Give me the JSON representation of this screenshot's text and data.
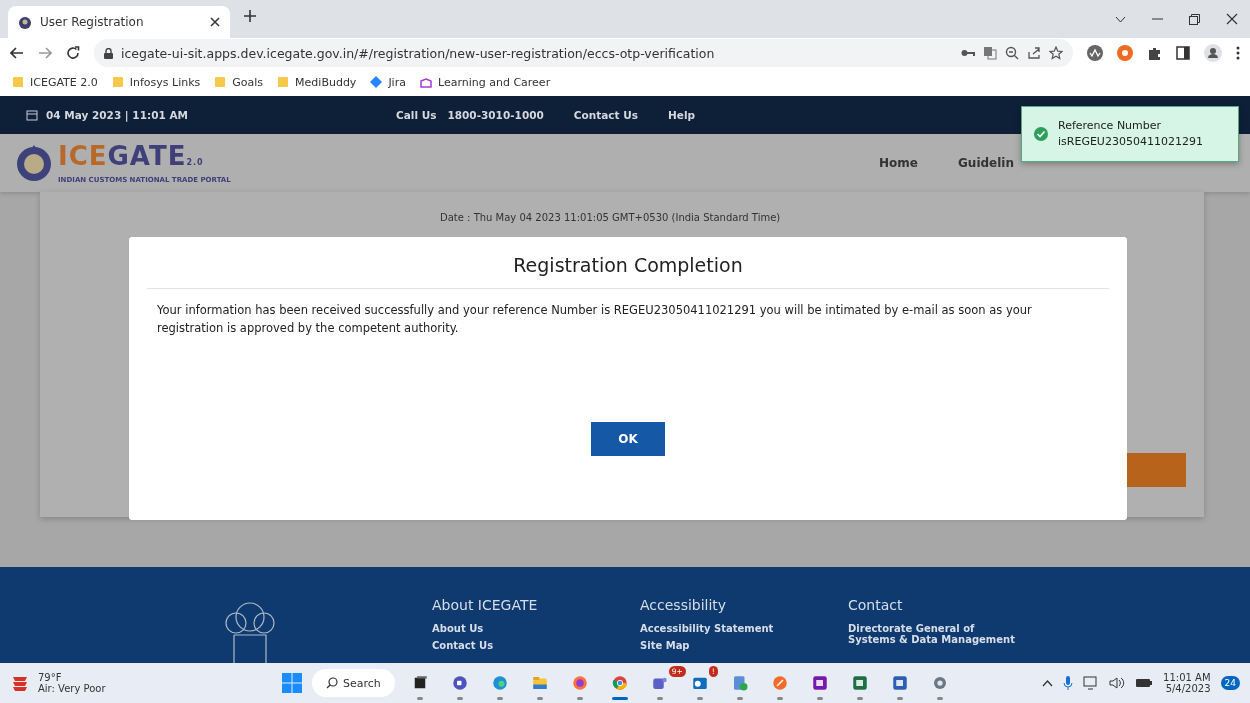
{
  "browser": {
    "tab": {
      "title": "User Registration",
      "selected": true
    },
    "url": "icegate-ui-sit.apps.dev.icegate.gov.in/#/registration/new-user-registration/eccs-otp-verification",
    "bookmarks": [
      {
        "label": "ICEGATE 2.0",
        "kind": "folder"
      },
      {
        "label": "Infosys Links",
        "kind": "folder"
      },
      {
        "label": "Goals",
        "kind": "folder"
      },
      {
        "label": "MediBuddy",
        "kind": "folder"
      },
      {
        "label": "Jira",
        "kind": "jira"
      },
      {
        "label": "Learning and Career",
        "kind": "learning"
      }
    ]
  },
  "site": {
    "date_time": "04 May 2023 | 11:01 AM",
    "call_label": "Call Us",
    "phone": "1800-3010-1000",
    "top_links": [
      "Contact Us",
      "Help"
    ],
    "logo": {
      "first": "ICE",
      "second": "GATE",
      "version": "2.0",
      "tagline": "INDIAN CUSTOMS NATIONAL TRADE PORTAL"
    },
    "nav": [
      "Home",
      "Guidelin"
    ],
    "date_line": "Date : Thu May 04 2023 11:01:05 GMT+0530 (India Standard Time)",
    "footer": [
      {
        "heading": "About ICEGATE",
        "links": [
          "About Us",
          "Contact Us"
        ]
      },
      {
        "heading": "Accessibility",
        "links": [
          "Accessibility Statement",
          "Site Map"
        ]
      },
      {
        "heading": "Contact",
        "links": [
          "Directorate General of Systems & Data Management"
        ]
      }
    ]
  },
  "toast": {
    "title": "Reference Number",
    "message": "isREGEU23050411021291"
  },
  "modal": {
    "title": "Registration Completion",
    "message": "Your information has been received successfully and your reference Number is REGEU23050411021291 you will be intimated by e-mail as soon as your registration is approved by the competent authority.",
    "button": "OK"
  },
  "taskbar": {
    "temperature": "79°F",
    "air": "Air: Very Poor",
    "search": "Search",
    "apps": [
      {
        "kind": "taskview",
        "active": false
      },
      {
        "kind": "meet",
        "active": false
      },
      {
        "kind": "edge",
        "active": false
      },
      {
        "kind": "files",
        "active": false
      },
      {
        "kind": "firefox",
        "active": false
      },
      {
        "kind": "chrome",
        "active": true
      },
      {
        "kind": "teams",
        "active": false,
        "badge": "9+"
      },
      {
        "kind": "outlook",
        "active": false,
        "badge": "!"
      },
      {
        "kind": "project",
        "active": false
      },
      {
        "kind": "compass",
        "active": false
      },
      {
        "kind": "onenote",
        "active": false
      },
      {
        "kind": "excel",
        "active": false
      },
      {
        "kind": "word",
        "active": false
      },
      {
        "kind": "settings",
        "active": false
      }
    ],
    "time": "11:01 AM",
    "date": "5/4/2023",
    "notifications": "24"
  }
}
